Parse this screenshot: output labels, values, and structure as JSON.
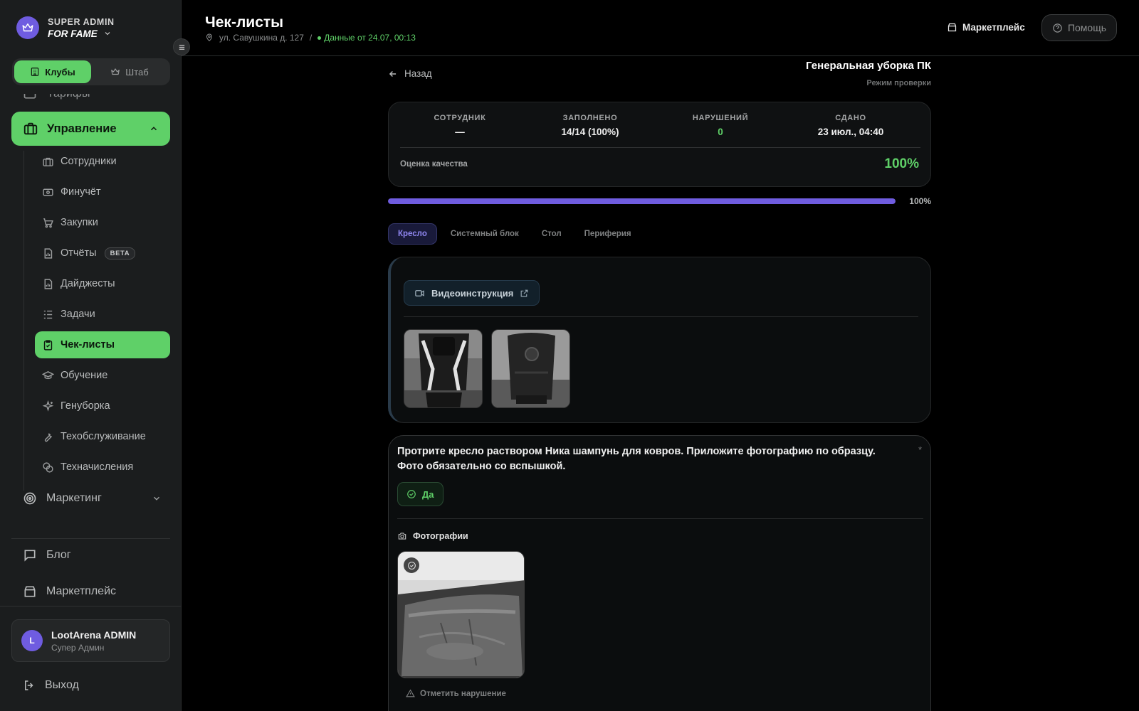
{
  "brand": {
    "top": "SUPER ADMIN",
    "bottom": "FOR FAME"
  },
  "switch": {
    "clubs": "Клубы",
    "staff": "Штаб"
  },
  "nav": {
    "partial": "Тарифы",
    "manage": "Управление",
    "sub": [
      {
        "label": "Сотрудники"
      },
      {
        "label": "Финучёт"
      },
      {
        "label": "Закупки"
      },
      {
        "label": "Отчёты",
        "badge": "BETA"
      },
      {
        "label": "Дайджесты"
      },
      {
        "label": "Задачи"
      },
      {
        "label": "Чек-листы"
      },
      {
        "label": "Обучение"
      },
      {
        "label": "Генуборка"
      },
      {
        "label": "Техобслуживание"
      },
      {
        "label": "Техначисления"
      }
    ],
    "marketing": "Маркетинг",
    "blog": "Блог",
    "marketplace": "Маркетплейс"
  },
  "user": {
    "initial": "L",
    "name": "LootArena ADMIN",
    "role": "Супер Админ"
  },
  "logout": "Выход",
  "header": {
    "title": "Чек-листы",
    "address": "ул. Савушкина д. 127",
    "separator": "/",
    "status": "Данные от 24.07, 00:13",
    "marketplace": "Маркетплейс",
    "help": "Помощь"
  },
  "checklist": {
    "back": "Назад",
    "title": "Генеральная уборка ПК",
    "mode": "Режим проверки",
    "stats": {
      "employee_label": "СОТРУДНИК",
      "employee_value": "—",
      "filled_label": "ЗАПОЛНЕНО",
      "filled_value": "14/14 (100%)",
      "violations_label": "НАРУШЕНИЙ",
      "violations_value": "0",
      "submitted_label": "СДАНО",
      "submitted_value": "23 июл., 04:40"
    },
    "quality_label": "Оценка качества",
    "quality_value": "100%",
    "progress_percent": 100,
    "progress_text": "100%",
    "tabs": [
      "Кресло",
      "Системный блок",
      "Стол",
      "Периферия"
    ],
    "video_label": "Видеоинструкция",
    "question": "Протрите кресло раствором Ника шампунь для ковров.  Приложите фотографию по образцу. Фото обязательно со вспышкой.",
    "required": "*",
    "answer": "Да",
    "photos_label": "Фотографии",
    "violation_label": "Отметить нарушение"
  },
  "colors": {
    "accent_green": "#5fd068",
    "accent_purple": "#6f5ce0",
    "background": "#000000",
    "sidebar": "#1b1d1e"
  }
}
